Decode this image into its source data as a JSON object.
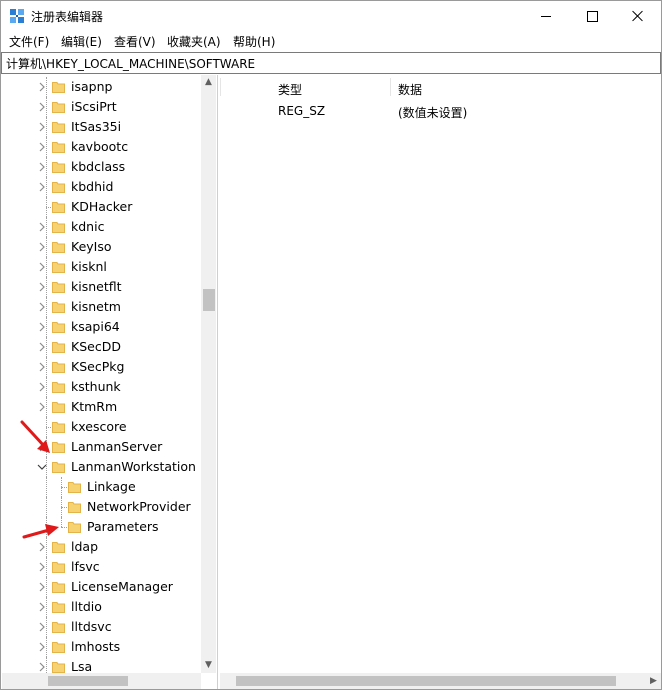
{
  "window": {
    "title": "注册表编辑器",
    "minimize_label": "",
    "maximize_label": "",
    "close_label": ""
  },
  "menu": {
    "items": [
      "文件(F)",
      "编辑(E)",
      "查看(V)",
      "收藏夹(A)",
      "帮助(H)"
    ]
  },
  "address": {
    "path": "计算机\\HKEY_LOCAL_MACHINE\\SOFTWARE"
  },
  "tree": {
    "items": [
      {
        "label": "isapnp",
        "expander": "collapsed"
      },
      {
        "label": "iScsiPrt",
        "expander": "collapsed"
      },
      {
        "label": "ItSas35i",
        "expander": "collapsed"
      },
      {
        "label": "kavbootc",
        "expander": "collapsed"
      },
      {
        "label": "kbdclass",
        "expander": "collapsed"
      },
      {
        "label": "kbdhid",
        "expander": "collapsed"
      },
      {
        "label": "KDHacker",
        "expander": "none"
      },
      {
        "label": "kdnic",
        "expander": "collapsed"
      },
      {
        "label": "KeyIso",
        "expander": "collapsed"
      },
      {
        "label": "kisknl",
        "expander": "collapsed"
      },
      {
        "label": "kisnetflt",
        "expander": "collapsed"
      },
      {
        "label": "kisnetm",
        "expander": "collapsed"
      },
      {
        "label": "ksapi64",
        "expander": "collapsed"
      },
      {
        "label": "KSecDD",
        "expander": "collapsed"
      },
      {
        "label": "KSecPkg",
        "expander": "collapsed"
      },
      {
        "label": "ksthunk",
        "expander": "collapsed"
      },
      {
        "label": "KtmRm",
        "expander": "collapsed"
      },
      {
        "label": "kxescore",
        "expander": "none"
      },
      {
        "label": "LanmanServer",
        "expander": "collapsed"
      },
      {
        "label": "LanmanWorkstation",
        "expander": "expanded"
      },
      {
        "label": "Linkage",
        "expander": "child"
      },
      {
        "label": "NetworkProvider",
        "expander": "child"
      },
      {
        "label": "Parameters",
        "expander": "child"
      },
      {
        "label": "ldap",
        "expander": "collapsed"
      },
      {
        "label": "lfsvc",
        "expander": "collapsed"
      },
      {
        "label": "LicenseManager",
        "expander": "collapsed"
      },
      {
        "label": "lltdio",
        "expander": "collapsed"
      },
      {
        "label": "lltdsvc",
        "expander": "collapsed"
      },
      {
        "label": "lmhosts",
        "expander": "collapsed"
      },
      {
        "label": "Lsa",
        "expander": "collapsed"
      }
    ]
  },
  "values": {
    "columns": [
      "类型",
      "数据"
    ],
    "rows": [
      {
        "type": "REG_SZ",
        "data": "(数值未设置)"
      }
    ]
  },
  "colors": {
    "folder": "#f6d271",
    "folder_dark": "#e4b44a",
    "annotation_arrow": "#e01a1a",
    "scroll_thumb": "#c2c2c2"
  },
  "icons": {
    "app": "regedit-icon",
    "folder": "folder-icon",
    "collapsed": "chevron-right-icon",
    "expanded": "chevron-down-icon"
  }
}
